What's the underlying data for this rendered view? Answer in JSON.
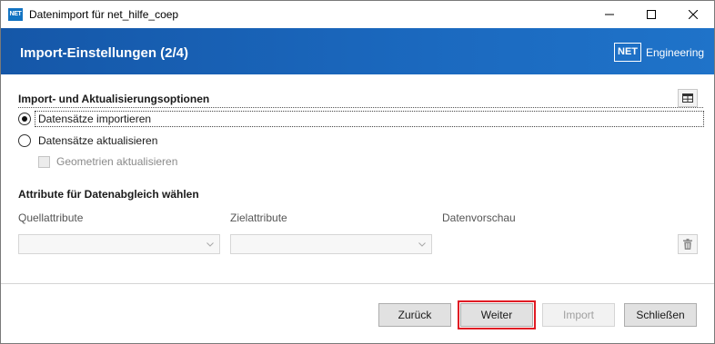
{
  "window": {
    "app_icon_text": "NET",
    "title": "Datenimport für net_hilfe_coep",
    "minimize_label": "—",
    "maximize_label": "☐",
    "close_label": "✕"
  },
  "banner": {
    "title": "Import-Einstellungen (2/4)",
    "brand_box": "NET",
    "brand_text": "Engineering"
  },
  "options": {
    "title": "Import- und Aktualisierungsoptionen",
    "radio_import": "Datensätze importieren",
    "radio_update": "Datensätze aktualisieren",
    "checkbox_geometry": "Geometrien aktualisieren",
    "selected": "radio_import"
  },
  "matching": {
    "title": "Attribute für Datenabgleich wählen",
    "source_label": "Quellattribute",
    "target_label": "Zielattribute",
    "preview_label": "Datenvorschau",
    "source_value": "",
    "target_value": ""
  },
  "footer": {
    "back": "Zurück",
    "next": "Weiter",
    "import": "Import",
    "close": "Schließen"
  },
  "colors": {
    "banner": "#1b69bf",
    "highlight": "#e01b24"
  },
  "icons": {
    "grid": "table-grid-icon",
    "trash": "trash-icon",
    "chevron": "chevron-down-icon"
  }
}
